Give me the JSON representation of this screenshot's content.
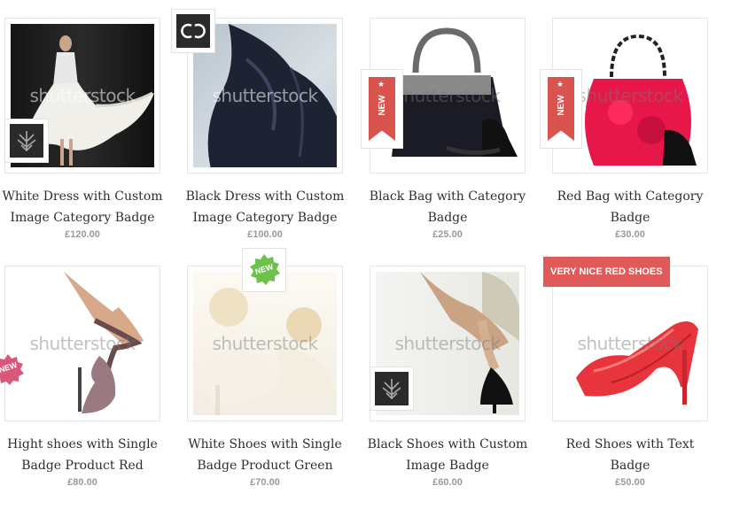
{
  "products": [
    {
      "title_line1": "White Dress with Custom",
      "title_line2": "Image Category Badge",
      "price": "£120.00",
      "watermark": "shutterstock"
    },
    {
      "title_line1": "Black Dress with Custom",
      "title_line2": "Image Category Badge",
      "price": "£100.00",
      "watermark": "shutterstock"
    },
    {
      "title_line1": "Black Bag with Category",
      "title_line2": "Badge",
      "price": "£25.00",
      "watermark": "shutterstock",
      "badge_text": "NEW"
    },
    {
      "title_line1": "Red Bag with Category",
      "title_line2": "Badge",
      "price": "£30.00",
      "watermark": "shutterstock",
      "badge_text": "NEW"
    },
    {
      "title_line1": "Hight shoes with Single",
      "title_line2": "Badge Product Red",
      "price": "£80.00",
      "watermark": "shutterstock",
      "badge_text": "NEW"
    },
    {
      "title_line1": "White Shoes with Single",
      "title_line2": "Badge Product Green",
      "price": "£70.00",
      "watermark": "shutterstock",
      "badge_text": "NEW"
    },
    {
      "title_line1": "Black Shoes with Custom",
      "title_line2": "Image Badge",
      "price": "£60.00",
      "watermark": "shutterstock"
    },
    {
      "title_line1": "Red Shoes with Text",
      "title_line2": "Badge",
      "price": "£50.00",
      "watermark": "shutterstock",
      "badge_text": "VERY NICE RED SHOES"
    }
  ],
  "colors": {
    "badge_red": "#d9534f",
    "text_badge_red": "#e05a5a",
    "badge_green": "#6cc24a",
    "badge_pink": "#d9577a"
  }
}
